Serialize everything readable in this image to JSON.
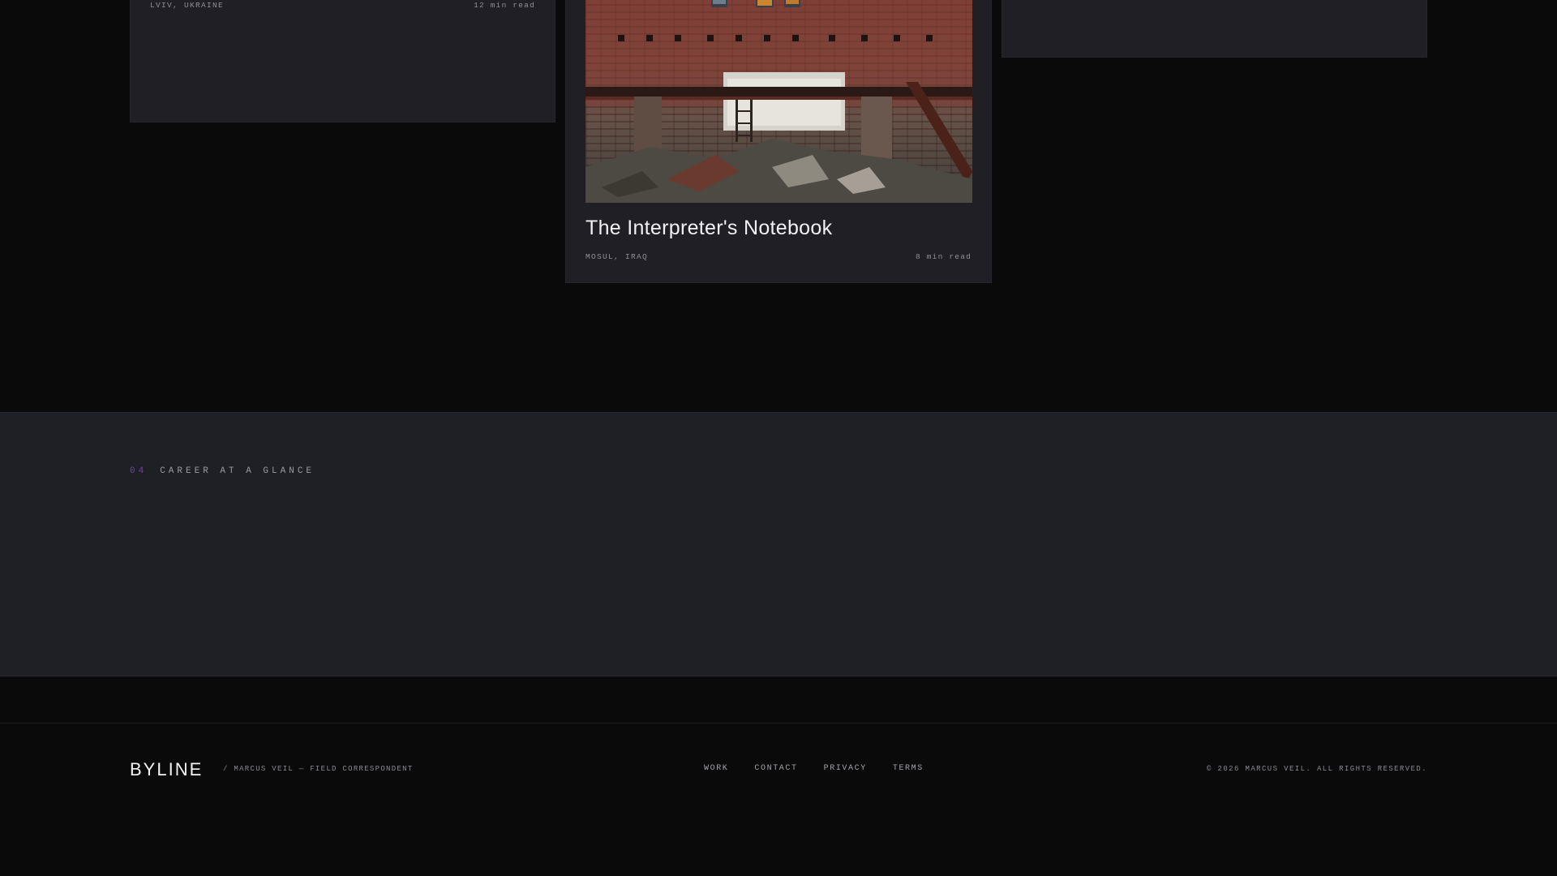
{
  "stories": [
    {
      "location": "LVIV, UKRAINE",
      "read_time": "12 min read"
    },
    {
      "title": "The Interpreter's Notebook",
      "location": "MOSUL, IRAQ",
      "read_time": "8 min read",
      "image_alt": "Bombed-out brick building interior with rubble"
    }
  ],
  "career": {
    "number": "04",
    "label": "CAREER AT A GLANCE"
  },
  "footer": {
    "brand": "BYLINE",
    "tagline": "/ MARCUS VEIL — FIELD CORRESPONDENT",
    "nav": [
      "WORK",
      "CONTACT",
      "PRIVACY",
      "TERMS"
    ],
    "copyright": "© 2026 MARCUS VEIL. ALL RIGHTS RESERVED."
  },
  "colors": {
    "accent": "#7a3fa6",
    "background": "#0a0a0b",
    "surface": "#1f1f25"
  }
}
